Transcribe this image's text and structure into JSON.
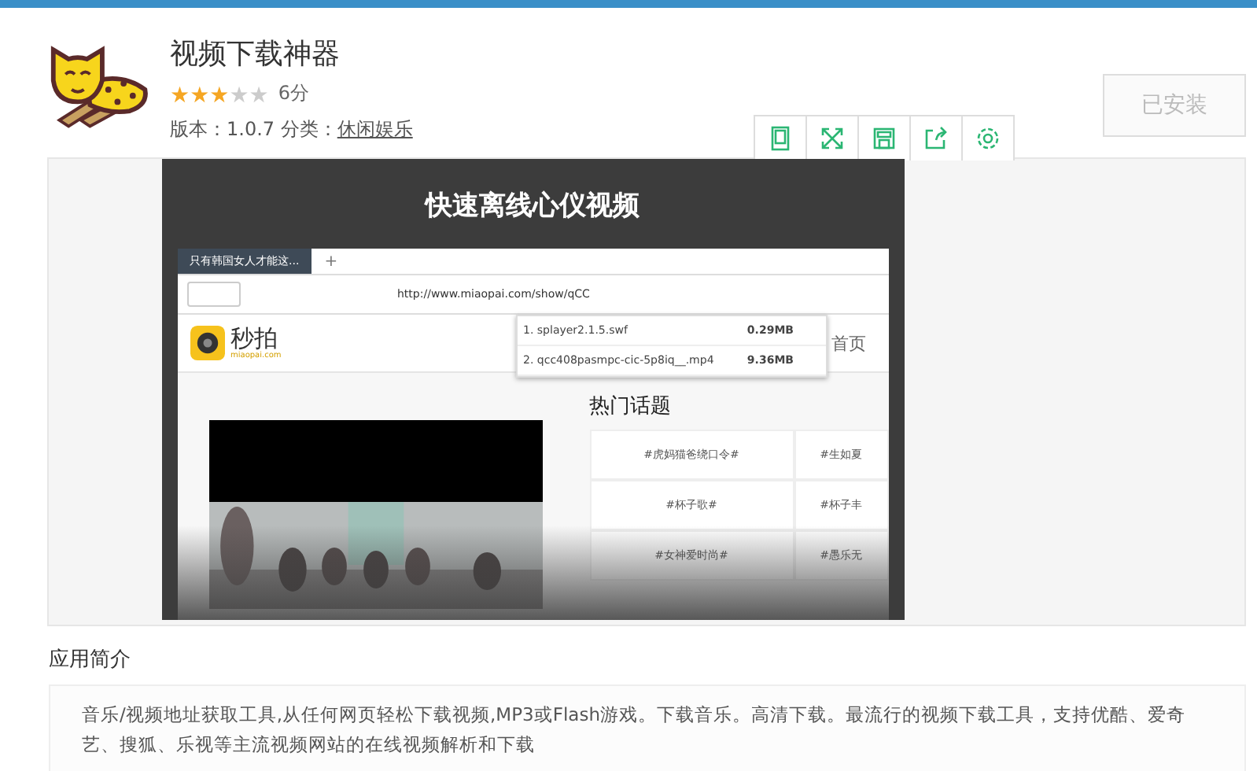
{
  "app": {
    "name": "视频下载神器",
    "stars": 3,
    "score": "6分",
    "version_label": "版本：1.0.7 分类：",
    "category": "休闲娱乐",
    "install_button": "已安装"
  },
  "toolbar": [
    {
      "kind": "tablet"
    },
    {
      "kind": "expand"
    },
    {
      "kind": "save"
    },
    {
      "kind": "share"
    },
    {
      "kind": "settings"
    }
  ],
  "screenshot": {
    "title": "快速离线心仪视频",
    "browser": {
      "tab": "只有韩国女人才能这...",
      "new_tab": "+",
      "url": "http://www.miaopai.com/show/qCC",
      "downloads": [
        {
          "name": "1. splayer2.1.5.swf",
          "size": "0.29MB"
        },
        {
          "name": "2. qcc408pasmpc-cic-5p8iq__.mp4",
          "size": "9.36MB"
        }
      ],
      "site_name": "秒拍",
      "site_domain": "miaopai.com",
      "nav": "首页",
      "topics_title": "热门话题",
      "topics": [
        "#虎妈猫爸绕口令#",
        "#生如夏",
        "#杯子歌#",
        "#杯子丰",
        "#女神爱时尚#",
        "#愚乐无"
      ]
    }
  },
  "intro": {
    "heading": "应用简介",
    "text": "音乐/视频地址获取工具,从任何网页轻松下载视频,MP3或Flash游戏。下载音乐。高清下载。最流行的视频下载工具，支持优酷、爱奇艺、搜狐、乐视等主流视频网站的在线视频解析和下载"
  }
}
